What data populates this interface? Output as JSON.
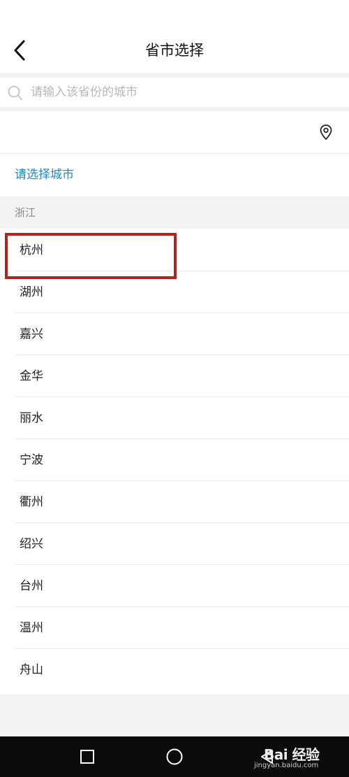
{
  "header": {
    "title": "省市选择",
    "back_icon": "chevron-left-icon"
  },
  "search": {
    "placeholder": "请输入该省份的城市",
    "value": "",
    "icon": "search-icon"
  },
  "location": {
    "icon": "location-pin-icon"
  },
  "prompt": "请选择城市",
  "province": "浙江",
  "cities": [
    "杭州",
    "湖州",
    "嘉兴",
    "金华",
    "丽水",
    "宁波",
    "衢州",
    "绍兴",
    "台州",
    "温州",
    "舟山"
  ],
  "annotation": {
    "highlighted_city": "杭州",
    "color": "#b3221b"
  },
  "colors": {
    "accent": "#2387c8",
    "band": "#f3f3f3",
    "nav_bar": "#0b0b0b"
  },
  "navbar": {
    "buttons": [
      "recent-apps-icon",
      "home-icon",
      "back-icon"
    ]
  },
  "watermark": {
    "line1": "Bai 经验",
    "line2": "jingyan.baidu.com"
  }
}
